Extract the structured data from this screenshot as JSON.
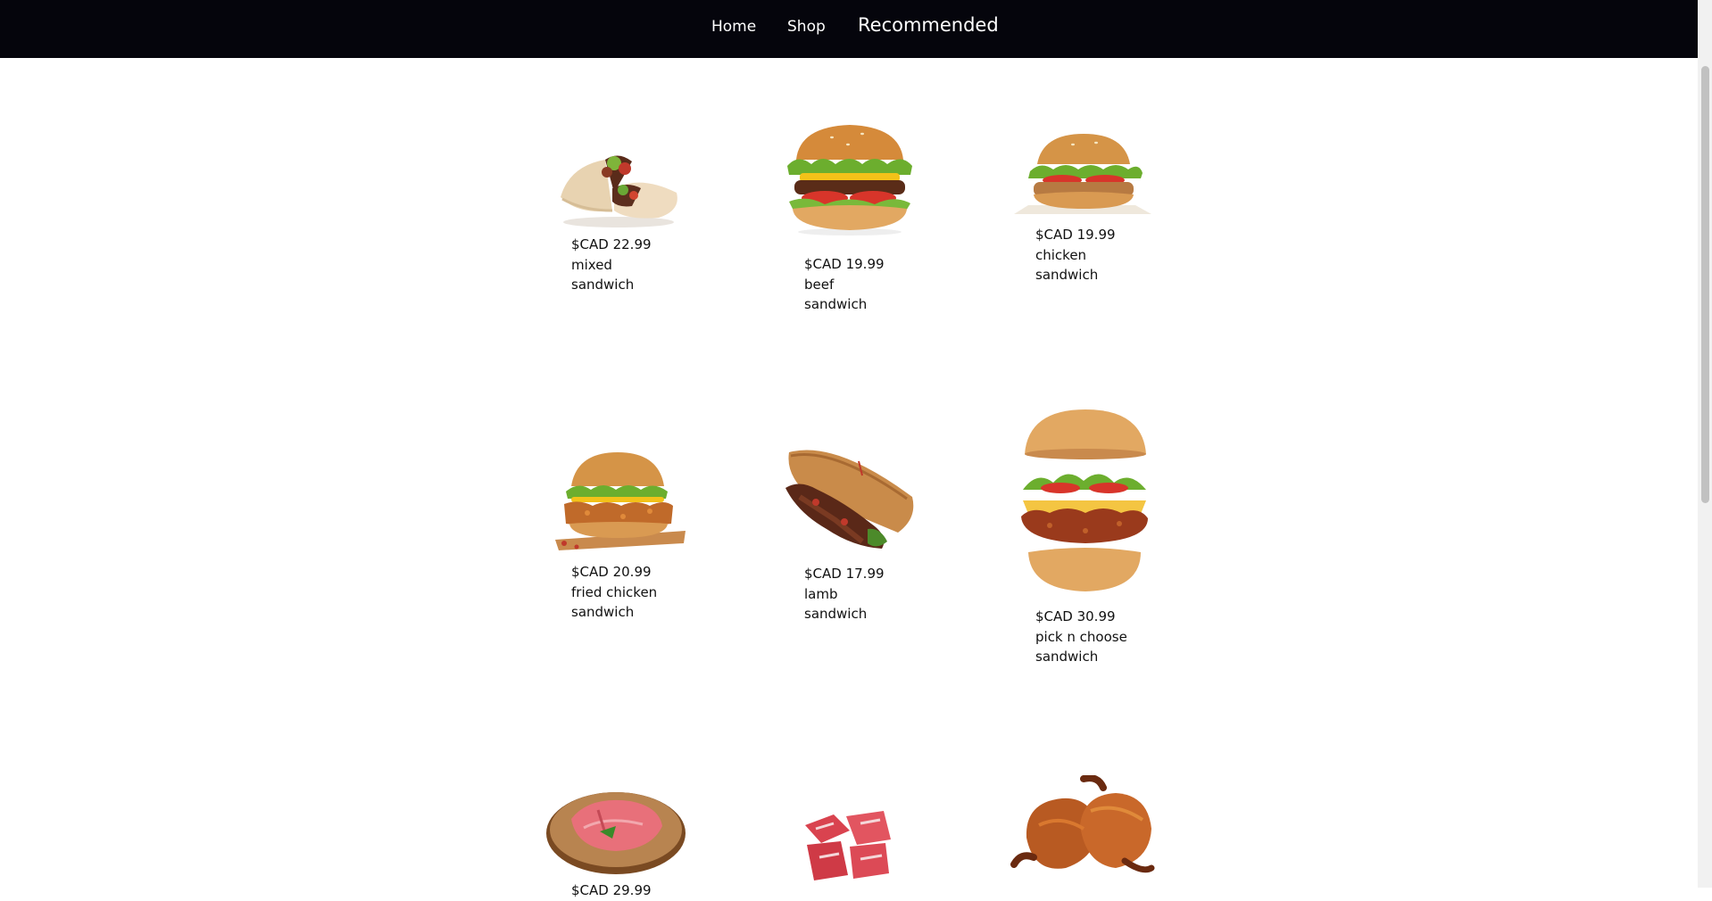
{
  "nav": {
    "home_label": "Home",
    "shop_label": "Shop",
    "recommended_label": "Recommended"
  },
  "products": [
    {
      "price": "$CAD 22.99",
      "name_line1": "mixed",
      "name_line2": "sandwich",
      "image_icon": "wrap-sandwich-icon"
    },
    {
      "price": "$CAD 19.99",
      "name_line1": "beef",
      "name_line2": "sandwich",
      "image_icon": "beef-burger-icon"
    },
    {
      "price": "$CAD 19.99",
      "name_line1": "chicken",
      "name_line2": "sandwich",
      "image_icon": "chicken-burger-icon"
    },
    {
      "price": "$CAD 20.99",
      "name_line1": "fried chicken",
      "name_line2": "sandwich",
      "image_icon": "fried-chicken-burger-icon"
    },
    {
      "price": "$CAD 17.99",
      "name_line1": "lamb",
      "name_line2": "sandwich",
      "image_icon": "lamb-pita-icon"
    },
    {
      "price": "$CAD 30.99",
      "name_line1": "pick n choose",
      "name_line2": "sandwich",
      "image_icon": "deconstructed-burger-icon"
    },
    {
      "price": "$CAD 29.99",
      "image_icon": "raw-meat-board-icon"
    },
    {
      "image_icon": "meat-cubes-icon"
    },
    {
      "image_icon": "roast-chicken-icon"
    }
  ],
  "colors": {
    "navbar_bg": "#05050c",
    "nav_text": "#ffffff",
    "page_bg": "#ffffff"
  }
}
